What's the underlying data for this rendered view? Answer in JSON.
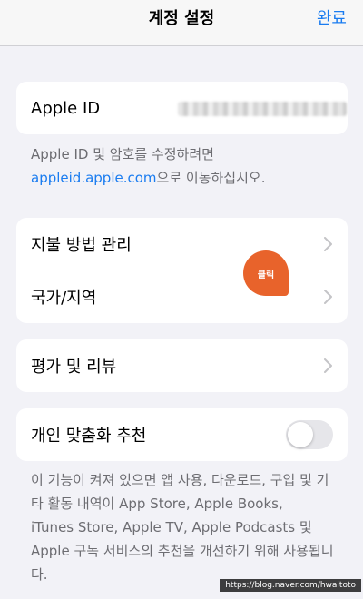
{
  "navbar": {
    "title": "계정 설정",
    "done_label": "완료"
  },
  "apple_id_card": {
    "label": "Apple ID"
  },
  "apple_id_note": {
    "line1": "Apple ID 및 암호를 수정하려면",
    "link": "appleid.apple.com",
    "line2_suffix": "으로 이동하십시오."
  },
  "settings_card": {
    "items": [
      {
        "label": "지불 방법 관리"
      },
      {
        "label": "국가/지역"
      }
    ]
  },
  "ratings_card": {
    "label": "평가 및 리뷰"
  },
  "personalized_card": {
    "label": "개인 맞춤화 추천",
    "toggle_on": false
  },
  "personalized_note": {
    "lines": [
      "이 기능이 켜져 있으면 앱 사용, 다운로드, 구입 및 기",
      "타 활동 내역이 App Store, Apple Books,",
      "iTunes Store, Apple TV, Apple Podcasts 및",
      "Apple 구독 서비스의 추천을 개선하기 위해 사용됩니",
      "다."
    ]
  },
  "annotation": {
    "label": "클릭",
    "color": "#e8632b"
  },
  "watermark": {
    "text": "https://blog.naver.com/hwaitoto"
  },
  "colors": {
    "accent": "#1a7cf0",
    "background": "#f2f2f7"
  }
}
